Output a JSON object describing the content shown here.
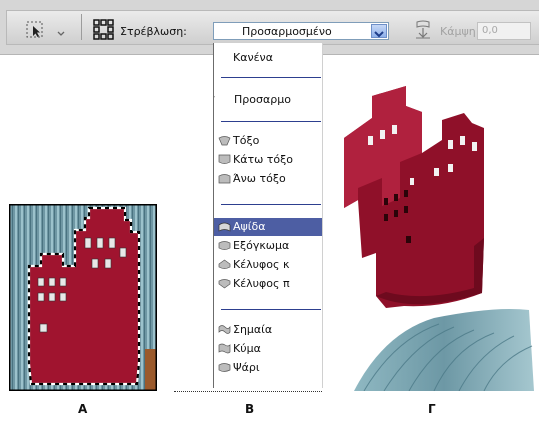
{
  "toolbar": {
    "warp_label": "Στρέβλωση:",
    "warp_value": "Προσαρμοσμένο",
    "curve_label": "Κάμψη:",
    "curve_value": "0,0"
  },
  "menu": {
    "none": "Κανένα",
    "custom": "Προσαρμο",
    "arc": "Τόξο",
    "arc_lower": "Κάτω τόξο",
    "arc_upper": "Άνω τόξο",
    "arch": "Αψίδα",
    "bulge": "Εξόγκωμα",
    "shell_lower": "Κέλυφος κ",
    "shell_upper": "Κέλυφος π",
    "flag": "Σημαία",
    "wave": "Κύμα",
    "fish": "Ψάρι"
  },
  "captions": {
    "a": "A",
    "b": "B",
    "c": "Γ"
  },
  "colors": {
    "highlight": "#4d5ea3",
    "building": "#9b1530",
    "separator": "#2d3f8f"
  }
}
